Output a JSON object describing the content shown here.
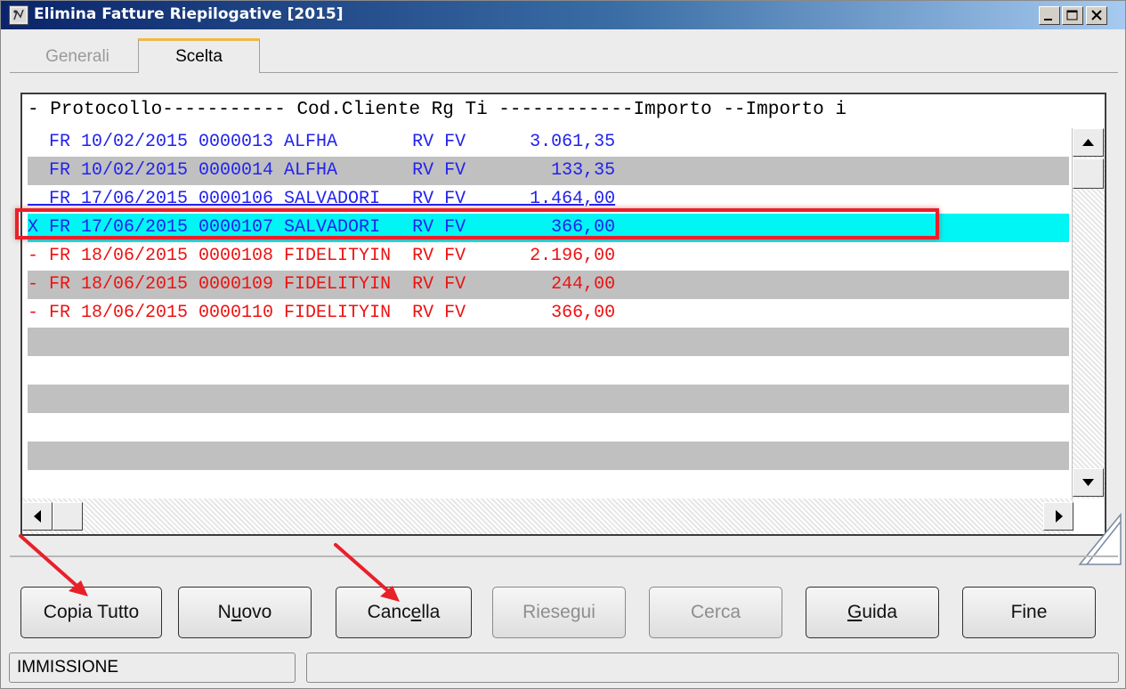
{
  "window": {
    "title": "Elimina Fatture Riepilogative [2015]"
  },
  "tabs": [
    {
      "label": "Generali",
      "active": false
    },
    {
      "label": "Scelta",
      "active": true
    }
  ],
  "list": {
    "header": "- Protocollo----------- Cod.Cliente Rg Ti ------------Importo --Importo i",
    "rows": [
      {
        "mark": " ",
        "reg": "FR",
        "date": "10/02/2015",
        "number": "0000013",
        "client": "ALFHA",
        "rg": "RV",
        "ti": "FV",
        "amount": "3.061,35",
        "color": "blue",
        "shade": "white"
      },
      {
        "mark": " ",
        "reg": "FR",
        "date": "10/02/2015",
        "number": "0000014",
        "client": "ALFHA",
        "rg": "RV",
        "ti": "FV",
        "amount": "133,35",
        "color": "blue",
        "shade": "gray"
      },
      {
        "mark": " ",
        "reg": "FR",
        "date": "17/06/2015",
        "number": "0000106",
        "client": "SALVADORI",
        "rg": "RV",
        "ti": "FV",
        "amount": "1.464,00",
        "color": "blue",
        "shade": "white"
      },
      {
        "mark": "X",
        "reg": "FR",
        "date": "17/06/2015",
        "number": "0000107",
        "client": "SALVADORI",
        "rg": "RV",
        "ti": "FV",
        "amount": "366,00",
        "color": "blue",
        "shade": "selected"
      },
      {
        "mark": "-",
        "reg": "FR",
        "date": "18/06/2015",
        "number": "0000108",
        "client": "FIDELITYIN",
        "rg": "RV",
        "ti": "FV",
        "amount": "2.196,00",
        "color": "red",
        "shade": "white"
      },
      {
        "mark": "-",
        "reg": "FR",
        "date": "18/06/2015",
        "number": "0000109",
        "client": "FIDELITYIN",
        "rg": "RV",
        "ti": "FV",
        "amount": "244,00",
        "color": "red",
        "shade": "gray"
      },
      {
        "mark": "-",
        "reg": "FR",
        "date": "18/06/2015",
        "number": "0000110",
        "client": "FIDELITYIN",
        "rg": "RV",
        "ti": "FV",
        "amount": "366,00",
        "color": "red",
        "shade": "white"
      }
    ]
  },
  "buttons": {
    "copia_tutto": {
      "pre": "Copia Tutto",
      "acc": "",
      "post": ""
    },
    "nuovo": {
      "pre": "N",
      "acc": "u",
      "post": "ovo"
    },
    "cancella": {
      "pre": "Canc",
      "acc": "e",
      "post": "lla"
    },
    "riesegui": {
      "pre": "Riesegui",
      "acc": "",
      "post": ""
    },
    "cerca": {
      "pre": "Cerca",
      "acc": "",
      "post": ""
    },
    "guida": {
      "pre": "",
      "acc": "G",
      "post": "uida"
    },
    "fine": {
      "pre": "Fine",
      "acc": "",
      "post": ""
    }
  },
  "status": {
    "mode": "IMMISSIONE",
    "message": ""
  },
  "colors": {
    "row_blue": "#2222ee",
    "row_red": "#ee1111",
    "row_gray": "#c0c0c0",
    "row_selected": "#00f5f5",
    "highlight_box": "#e8202a",
    "annotation_arrow": "#e8202a",
    "tab_accent": "#f0b848"
  }
}
